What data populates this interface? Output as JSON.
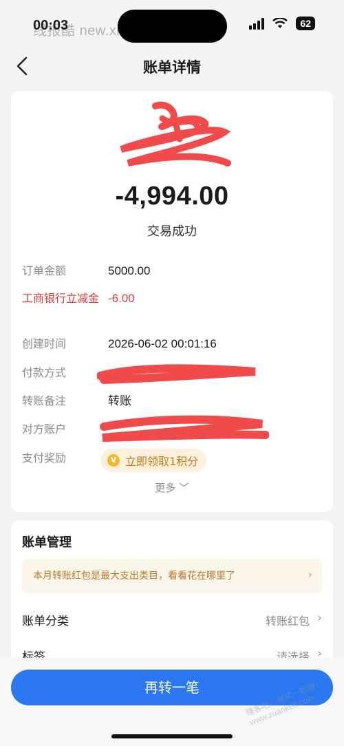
{
  "status_bar": {
    "time": "00:03",
    "watermark": "线报酷 new.xianbao.fun",
    "battery": "62"
  },
  "nav": {
    "title": "账单详情"
  },
  "summary": {
    "amount": "-4,994.00",
    "status": "交易成功"
  },
  "details": [
    {
      "label": "订单金额",
      "value": "5000.00"
    },
    {
      "label": "工商银行立减金",
      "value": "-6.00"
    },
    {
      "label": "创建时间",
      "value": "2026-06-02 00:01:16"
    },
    {
      "label": "付款方式",
      "value": ""
    },
    {
      "label": "转账备注",
      "value": "转账"
    },
    {
      "label": "对方账户",
      "value": ""
    },
    {
      "label": "支付奖励",
      "value": ""
    }
  ],
  "reward": {
    "coin": "V",
    "label": "立即领取1积分"
  },
  "more_label": "更多 ﹀",
  "management": {
    "title": "账单管理",
    "tip": "本月转账红包是最大支出类目，看看花在哪里了",
    "rows": [
      {
        "label": "账单分类",
        "value": "转账红包"
      },
      {
        "label": "标签",
        "value": "请选择"
      }
    ]
  },
  "cta": {
    "label": "再转一笔"
  },
  "watermark_bottom": "赚客吧，有奖一起赚！ www.zuanke8.com",
  "colors": {
    "accent": "#2a77f1",
    "discount_red": "#d63a3a",
    "redaction": "#f04a4a"
  }
}
